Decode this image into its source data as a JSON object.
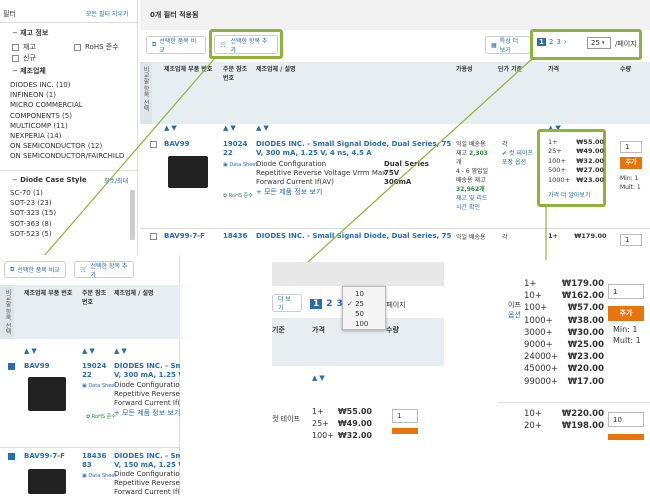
{
  "filters": {
    "title": "필터",
    "clear_all": "모든 필터 지우기",
    "stock_group": "재고 정보",
    "stock_options": [
      "재고",
      "RoHS 준수",
      "신규"
    ],
    "mfr_group": "제조업체",
    "manufacturers": [
      "DIODES INC. (10)",
      "INFINEON (1)",
      "MICRO COMMERCIAL",
      "COMPONENTS (5)",
      "MULTICOMP (11)",
      "NEXPERIA (14)",
      "ON SEMICONDUCTOR (12)",
      "ON SEMICONDUCTOR/FAIRCHILD"
    ],
    "case_group": "Diode Case Style",
    "case_minmax": "최소/최대",
    "cases": [
      "SC-70 (1)",
      "SOT-23 (23)",
      "SOT-323 (15)",
      "SOT-363 (8)",
      "SOT-523 (5)"
    ]
  },
  "toolbar": {
    "applied": "0개 필터 적용됨",
    "compare": "선택한 품목 비교",
    "add_selected": "선택한 항목 추가",
    "attr_view": "특성 더 보기",
    "pages": [
      "1",
      "2",
      "3",
      "›"
    ],
    "per_page_value": "25",
    "per_page_label": "/페이지"
  },
  "columns": {
    "compare": "비교할 항목 선택",
    "mfr_part": "제조업체 부품 번호",
    "order_code": "주문 참조 번호",
    "mfr_desc": "제조업체 / 설명",
    "availability": "가용성",
    "unit_price": "단가 기준",
    "price": "가격",
    "qty": "수량"
  },
  "rows": [
    {
      "part": "BAV99",
      "order1": "19024",
      "order2": "22",
      "datasheet": "Data Sheet",
      "rohs": "RoHS 준수",
      "title1": "DIODES INC. - Small Signal Diode, Dual Series, 75",
      "title2": "V, 300 mA, 1.25 V, 4 ns, 4.5 A",
      "spec1_k": "Diode Configuration",
      "spec1_v": "Dual Series",
      "spec2_k": "Repetitive Reverse Voltage Vrrm Max",
      "spec2_v": "75V",
      "spec3_k": "Forward Current If(AV)",
      "spec3_v": "300mA",
      "more": "+ 모든 제품 정보 보기",
      "avail1": "익일 배송용",
      "avail2": "재고 2,303",
      "avail3": "개",
      "avail4": "4 - 6 영업일",
      "avail5": "배송용 재고",
      "avail6": "32,962개",
      "avail7": "재고 및 리드",
      "avail8": "시간 확인",
      "unit1": "각",
      "unit2": "컷 테이프",
      "unit3": "포장 옵션",
      "prices": [
        [
          "1+",
          "₩55.00"
        ],
        [
          "25+",
          "₩49.00"
        ],
        [
          "100+",
          "₩32.00"
        ],
        [
          "500+",
          "₩27.00"
        ],
        [
          "1000+",
          "₩23.00"
        ]
      ],
      "more_prices": "가격 더 알아보기",
      "qty": "1",
      "add": "추가",
      "min": "Min: 1",
      "mult": "Mult: 1"
    },
    {
      "part": "BAV99-7-F",
      "order1": "18436",
      "order2": "83",
      "title1": "DIODES INC. - Small Signal Diode, Dual Series, 75",
      "title2": "V, 150 mA, 1.25 V, 4 ns,",
      "spec1_k": "Diode Configuration",
      "spec2_k": "Repetitive Reverse Vo",
      "spec3_k": "Forward Current If(AV",
      "more": "+ 모든 제품 정보 보기",
      "avail1": "익일 배송용",
      "unit1": "각",
      "price1": "₩179.00",
      "qty": "1"
    }
  ],
  "dropdown": {
    "options": [
      "10",
      "25",
      "50",
      "100"
    ],
    "selected": "25"
  },
  "zoom_mid": {
    "attr_btn": "더 보기",
    "pages": [
      "1",
      "2",
      "3",
      "›"
    ],
    "per_page_value": "25",
    "per_page_label": "/페이지",
    "col_unit": "기준",
    "col_price": "가격",
    "col_qty": "수량",
    "unit": "컷 테이프",
    "prices": [
      [
        "1+",
        "₩55.00"
      ],
      [
        "25+",
        "₩49.00"
      ],
      [
        "100+",
        "₩32.00"
      ]
    ],
    "qty": "1"
  },
  "zoom_right": {
    "side1": "이프",
    "side2": "옵션",
    "prices": [
      [
        "1+",
        "₩179.00"
      ],
      [
        "10+",
        "₩162.00"
      ],
      [
        "100+",
        "₩57.00"
      ],
      [
        "1000+",
        "₩38.00"
      ],
      [
        "3000+",
        "₩30.00"
      ],
      [
        "9000+",
        "₩25.00"
      ],
      [
        "24000+",
        "₩23.00"
      ],
      [
        "45000+",
        "₩20.00"
      ],
      [
        "99000+",
        "₩17.00"
      ]
    ],
    "qty": "1",
    "add": "추가",
    "min": "Min: 1",
    "mult": "Mult: 1",
    "prices2": [
      [
        "10+",
        "₩220.00"
      ],
      [
        "20+",
        "₩198.00"
      ]
    ],
    "qty2": "10"
  },
  "colors": {
    "accent": "#8db33a",
    "link": "#2a6cb0",
    "add": "#e8740c",
    "header_bg": "#e6eef2"
  }
}
